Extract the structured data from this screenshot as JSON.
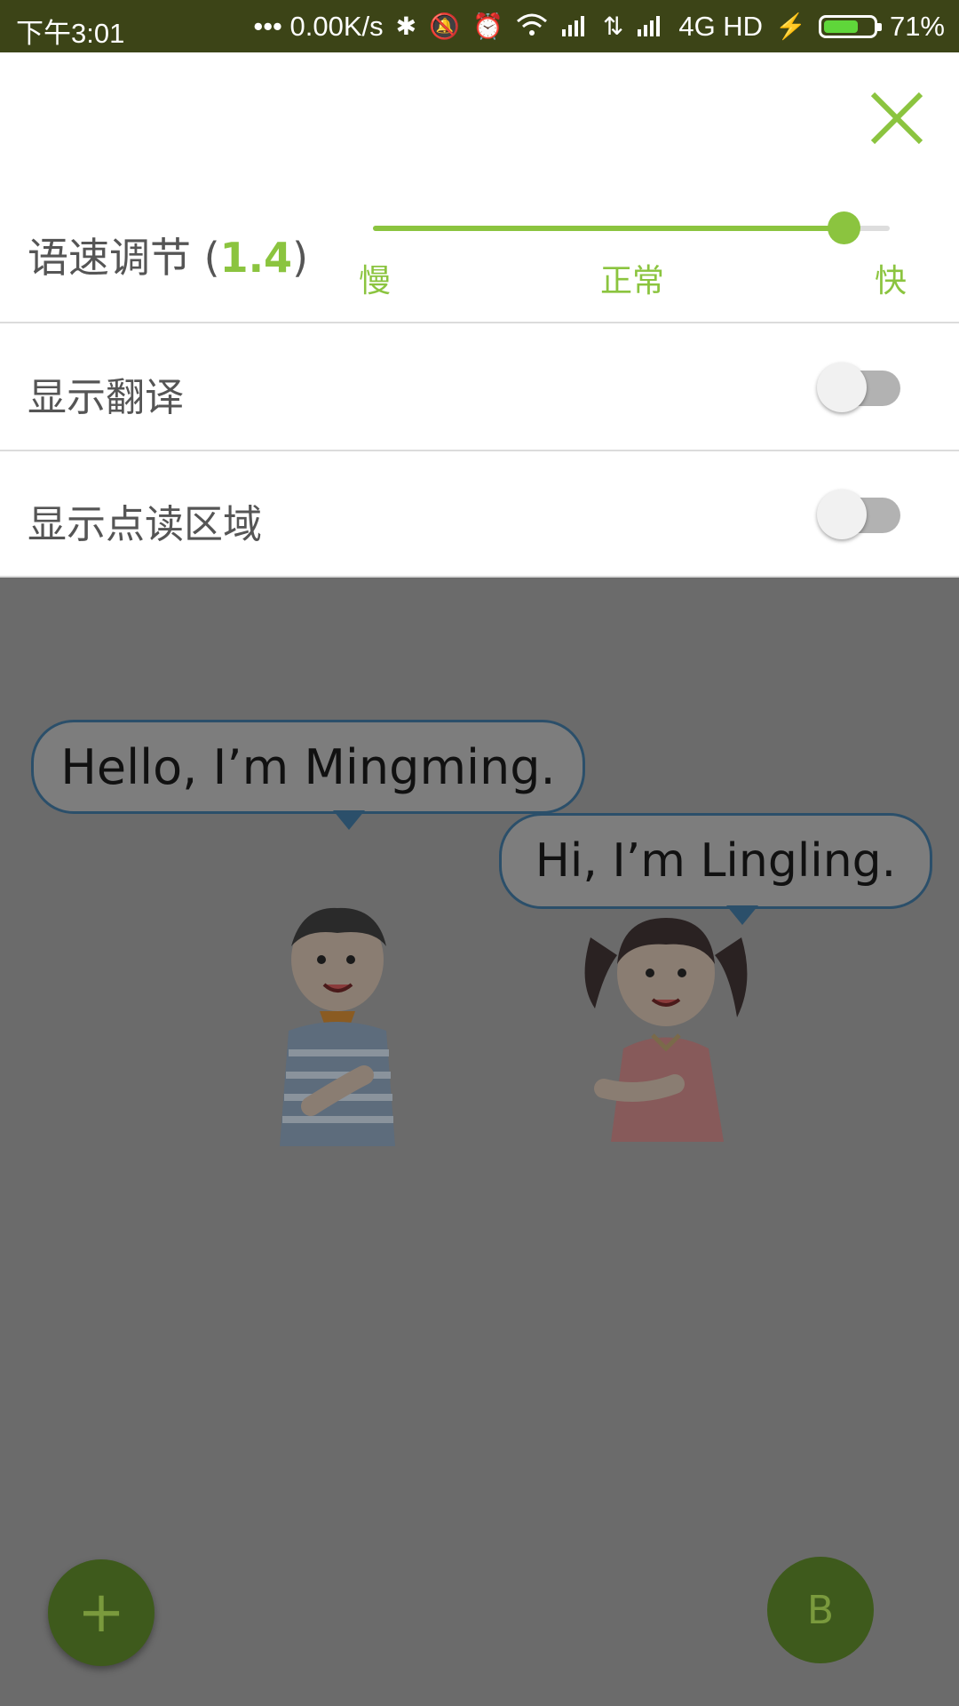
{
  "status_bar": {
    "time": "下午3:01",
    "network_speed": "••• 0.00K/s",
    "network_type": "4G HD",
    "battery_percent": "71%",
    "battery_level": 0.71
  },
  "settings": {
    "speed": {
      "label": "语速调节",
      "open_paren": " (",
      "value": "1.4",
      "close_paren": ")",
      "slider_fraction": 0.91,
      "tick_slow": "慢",
      "tick_normal": "正常",
      "tick_fast": "快"
    },
    "show_translation": {
      "label": "显示翻译",
      "enabled": false
    },
    "show_reading_area": {
      "label": "显示点读区域",
      "enabled": false
    }
  },
  "page": {
    "bubble_boy": "Hello, I’m Mingming.",
    "bubble_girl": "Hi, I’m Lingling."
  },
  "buttons": {
    "add_label": "+",
    "b_label": "B"
  },
  "colors": {
    "accent": "#8bc43f",
    "status_bar": "#3c4417",
    "overlay": "#6b6b6b",
    "fab": "#3e5a1c"
  }
}
